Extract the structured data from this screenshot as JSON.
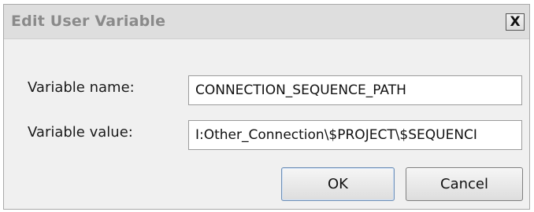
{
  "dialog": {
    "title": "Edit User Variable",
    "close_label": "X"
  },
  "form": {
    "name_label": "Variable name:",
    "name_value": "CONNECTION_SEQUENCE_PATH",
    "value_label": "Variable value:",
    "value_value": "I:Other_Connection\\$PROJECT\\$SEQUENCI"
  },
  "buttons": {
    "ok_label": "OK",
    "cancel_label": "Cancel"
  }
}
